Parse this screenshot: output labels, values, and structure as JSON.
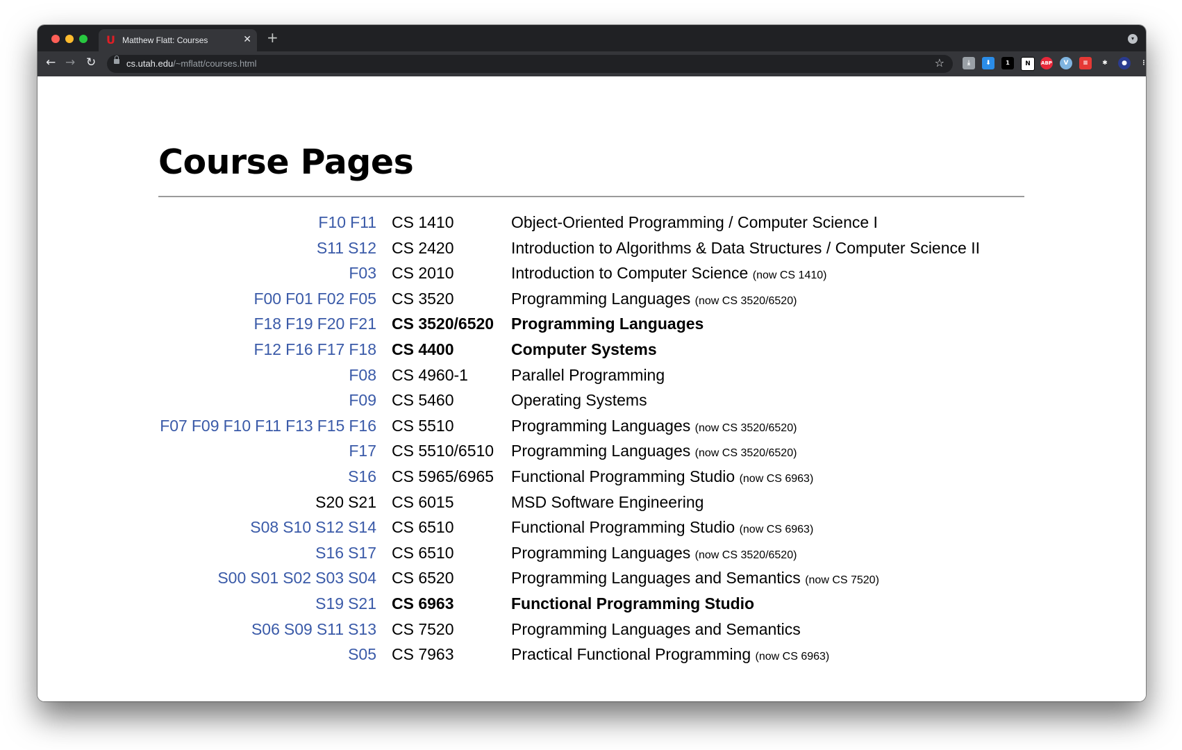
{
  "browser": {
    "tab_title": "Matthew Flatt: Courses",
    "tab_close": "✕",
    "new_tab": "+",
    "url_host": "cs.utah.edu",
    "url_path": "/~mflatt/courses.html",
    "nav_back": "←",
    "nav_forward": "→",
    "nav_reload": "↻",
    "bookmark_star": "☆",
    "extensions": [
      {
        "name": "download-manager-icon",
        "color": "#9aa0a6",
        "label": "⤓"
      },
      {
        "name": "downloader-icon",
        "color": "#2b8de8",
        "label": "⬇"
      },
      {
        "name": "media-extension-icon",
        "color": "#000000",
        "label": "1"
      },
      {
        "name": "notion-icon",
        "color": "#ffffff",
        "label": "N"
      },
      {
        "name": "adblock-plus-icon",
        "color": "#e8283a",
        "label": "ABP"
      },
      {
        "name": "vimeo-extension-icon",
        "color": "#7fb4e0",
        "label": "V"
      },
      {
        "name": "notes-extension-icon",
        "color": "#e53935",
        "label": "≡"
      },
      {
        "name": "extensions-puzzle-icon",
        "color": "#35363a",
        "label": "✱"
      },
      {
        "name": "profile-avatar-icon",
        "color": "#2a3b8f",
        "label": "●"
      },
      {
        "name": "menu-icon",
        "color": "#35363a",
        "label": "⋮"
      }
    ]
  },
  "page": {
    "title": "Course Pages",
    "courses": [
      {
        "terms": [
          {
            "label": "F10",
            "link": true
          },
          {
            "label": "F11",
            "link": true
          }
        ],
        "code": "CS 1410",
        "desc": "Object-Oriented Programming / Computer Science I",
        "note": "",
        "bold": false
      },
      {
        "terms": [
          {
            "label": "S11",
            "link": true
          },
          {
            "label": "S12",
            "link": true
          }
        ],
        "code": "CS 2420",
        "desc": "Introduction to Algorithms & Data Structures / Computer Science II",
        "note": "",
        "bold": false
      },
      {
        "terms": [
          {
            "label": "F03",
            "link": true
          }
        ],
        "code": "CS 2010",
        "desc": "Introduction to Computer Science",
        "note": "(now CS 1410)",
        "bold": false
      },
      {
        "terms": [
          {
            "label": "F00",
            "link": true
          },
          {
            "label": "F01",
            "link": true
          },
          {
            "label": "F02",
            "link": true
          },
          {
            "label": "F05",
            "link": true
          }
        ],
        "code": "CS 3520",
        "desc": "Programming Languages",
        "note": "(now CS 3520/6520)",
        "bold": false
      },
      {
        "terms": [
          {
            "label": "F18",
            "link": true
          },
          {
            "label": "F19",
            "link": true
          },
          {
            "label": "F20",
            "link": true
          },
          {
            "label": "F21",
            "link": true
          }
        ],
        "code": "CS 3520/6520",
        "desc": "Programming Languages",
        "note": "",
        "bold": true
      },
      {
        "terms": [
          {
            "label": "F12",
            "link": true
          },
          {
            "label": "F16",
            "link": true
          },
          {
            "label": "F17",
            "link": true
          },
          {
            "label": "F18",
            "link": true
          }
        ],
        "code": "CS 4400",
        "desc": "Computer Systems",
        "note": "",
        "bold": true
      },
      {
        "terms": [
          {
            "label": "F08",
            "link": true
          }
        ],
        "code": "CS 4960-1",
        "desc": "Parallel Programming",
        "note": "",
        "bold": false
      },
      {
        "terms": [
          {
            "label": "F09",
            "link": true
          }
        ],
        "code": "CS 5460",
        "desc": "Operating Systems",
        "note": "",
        "bold": false
      },
      {
        "terms": [
          {
            "label": "F07",
            "link": true
          },
          {
            "label": "F09",
            "link": true
          },
          {
            "label": "F10",
            "link": true
          },
          {
            "label": "F11",
            "link": true
          },
          {
            "label": "F13",
            "link": true
          },
          {
            "label": "F15",
            "link": true
          },
          {
            "label": "F16",
            "link": true
          }
        ],
        "code": "CS 5510",
        "desc": "Programming Languages",
        "note": "(now CS 3520/6520)",
        "bold": false
      },
      {
        "terms": [
          {
            "label": "F17",
            "link": true
          }
        ],
        "code": "CS 5510/6510",
        "desc": "Programming Languages",
        "note": "(now CS 3520/6520)",
        "bold": false
      },
      {
        "terms": [
          {
            "label": "S16",
            "link": true
          }
        ],
        "code": "CS 5965/6965",
        "desc": "Functional Programming Studio",
        "note": "(now CS 6963)",
        "bold": false
      },
      {
        "terms": [
          {
            "label": "S20",
            "link": false
          },
          {
            "label": "S21",
            "link": false
          }
        ],
        "code": "CS 6015",
        "desc": "MSD Software Engineering",
        "note": "",
        "bold": false
      },
      {
        "terms": [
          {
            "label": "S08",
            "link": true
          },
          {
            "label": "S10",
            "link": true
          },
          {
            "label": "S12",
            "link": true
          },
          {
            "label": "S14",
            "link": true
          }
        ],
        "code": "CS 6510",
        "desc": "Functional Programming Studio",
        "note": "(now CS 6963)",
        "bold": false
      },
      {
        "terms": [
          {
            "label": "S16",
            "link": true
          },
          {
            "label": "S17",
            "link": true
          }
        ],
        "code": "CS 6510",
        "desc": "Programming Languages",
        "note": "(now CS 3520/6520)",
        "bold": false
      },
      {
        "terms": [
          {
            "label": "S00",
            "link": true
          },
          {
            "label": "S01",
            "link": true
          },
          {
            "label": "S02",
            "link": true
          },
          {
            "label": "S03",
            "link": true
          },
          {
            "label": "S04",
            "link": true
          }
        ],
        "code": "CS 6520",
        "desc": "Programming Languages and Semantics",
        "note": "(now CS 7520)",
        "bold": false
      },
      {
        "terms": [
          {
            "label": "S19",
            "link": true
          },
          {
            "label": "S21",
            "link": true
          }
        ],
        "code": "CS 6963",
        "desc": "Functional Programming Studio",
        "note": "",
        "bold": true
      },
      {
        "terms": [
          {
            "label": "S06",
            "link": true
          },
          {
            "label": "S09",
            "link": true
          },
          {
            "label": "S11",
            "link": true
          },
          {
            "label": "S13",
            "link": true
          }
        ],
        "code": "CS 7520",
        "desc": "Programming Languages and Semantics",
        "note": "",
        "bold": false
      },
      {
        "terms": [
          {
            "label": "S05",
            "link": true
          }
        ],
        "code": "CS 7963",
        "desc": "Practical Functional Programming",
        "note": "(now CS 6963)",
        "bold": false
      }
    ]
  },
  "colors": {
    "link": "#3a5aa8",
    "tab_favicon": "#e01e25"
  }
}
